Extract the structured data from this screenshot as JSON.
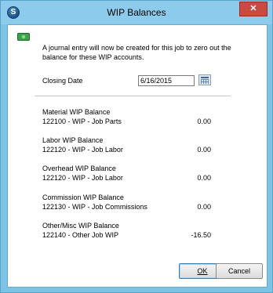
{
  "window": {
    "title": "WIP Balances",
    "close_glyph": "✕",
    "app_icon_letter": "S"
  },
  "intro": "A journal entry will now be created for this job to zero out the balance for these WIP accounts.",
  "closing_date": {
    "label": "Closing Date",
    "value": "6/16/2015"
  },
  "wip": [
    {
      "heading": "Material WIP Balance",
      "account": "122100 - WIP - Job Parts",
      "amount": "0.00"
    },
    {
      "heading": "Labor WIP Balance",
      "account": "122120 - WIP - Job Labor",
      "amount": "0.00"
    },
    {
      "heading": "Overhead WIP Balance",
      "account": "122120 - WIP - Job Labor",
      "amount": "0.00"
    },
    {
      "heading": "Commission WIP Balance",
      "account": "122130 - WIP - Job Commissions",
      "amount": "0.00"
    },
    {
      "heading": "Other/Misc WIP Balance",
      "account": "122140 - Other Job WIP",
      "amount": "-16.50"
    }
  ],
  "buttons": {
    "ok": "OK",
    "cancel": "Cancel"
  },
  "colors": {
    "titlebar": "#8ccbec",
    "close": "#c94a3f",
    "money_icon": "#3aa34a"
  }
}
